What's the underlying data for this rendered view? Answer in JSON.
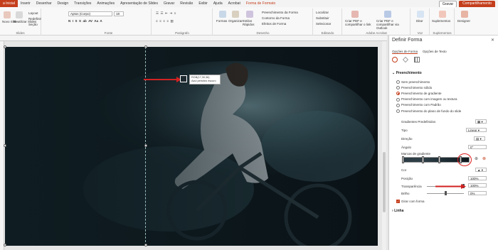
{
  "ribbon_tabs": [
    "a Inicial",
    "Inserir",
    "Desenhar",
    "Design",
    "Transições",
    "Animações",
    "Apresentação de Slides",
    "Gravar",
    "Revisão",
    "Exibir",
    "Ajuda",
    "Acrobat",
    "Forma de Formato"
  ],
  "ribbon_active_tab": "Forma de Formato",
  "header_buttons": {
    "gravar": "Gravar",
    "share": "Compartilhamento"
  },
  "ribbon": {
    "new_slide": "Novo Slide",
    "reuse_slides": "Reutilizar Slides",
    "layout": "Layout",
    "reset": "Redefinir",
    "section": "Seção",
    "group_slides": "Slides",
    "font_name": "Aptos (Corpo)",
    "font_size": "18",
    "group_font": "Fonte",
    "group_paragraph": "Parágrafo",
    "shapes": "Formas",
    "arrange": "Organizar",
    "quick_styles": "Estilos Rápidos",
    "fill": "Preenchimento da Forma",
    "outline": "Contorno da Forma",
    "effects": "Efeitos de Forma",
    "group_drawing": "Desenho",
    "find": "Localizar",
    "replace": "Substituir",
    "select": "Selecionar",
    "group_editing": "Editando",
    "pdf_share": "Criar PDF e compartilhar o link",
    "pdf_outlook": "Criar PDF e compartilhar via Outlook",
    "group_acrobat": "Adobe Acrobat",
    "dictate": "Ditar",
    "group_voice": "Voz",
    "addins": "Suplementos",
    "group_addins": "Suplementos",
    "designer": "Designer"
  },
  "color_tooltip": {
    "rgb": "RGB(17,30,36)",
    "name": "Azul petróleo escuro"
  },
  "pane": {
    "title": "Definir Forma",
    "tab_shape": "Opções de Forma",
    "tab_text": "Opções de Texto",
    "section_fill": "Preenchimento",
    "fill_options": [
      "Sem preenchimento",
      "Preenchimento sólido",
      "Preenchimento de gradiente",
      "Preenchimento com imagem ou textura",
      "Preenchimento com Padrão",
      "Preenchimento do plano de fundo do slide"
    ],
    "selected_fill": "Preenchimento de gradiente",
    "preset_label": "Gradientes Predefinidos",
    "type_label": "Tipo",
    "type_value": "Linear",
    "direction_label": "Direção",
    "angle_label": "Ângulo",
    "angle_value": "0°",
    "stops_label": "Marcas de gradiente",
    "color_label": "Cor",
    "position_label": "Posição",
    "position_value": "100%",
    "transparency_label": "Transparência",
    "transparency_value": "100%",
    "brightness_label": "Brilho",
    "brightness_value": "0%",
    "rotate_label": "Girar com forma",
    "section_line": "Linha"
  },
  "gradient_stops_pct": [
    0,
    30,
    55,
    88
  ],
  "colors": {
    "accent": "#c43e1c",
    "annotation": "#d22222",
    "stop_color": "#111e24"
  },
  "transparency_fraction": 1.0,
  "brightness_fraction": 0.5
}
